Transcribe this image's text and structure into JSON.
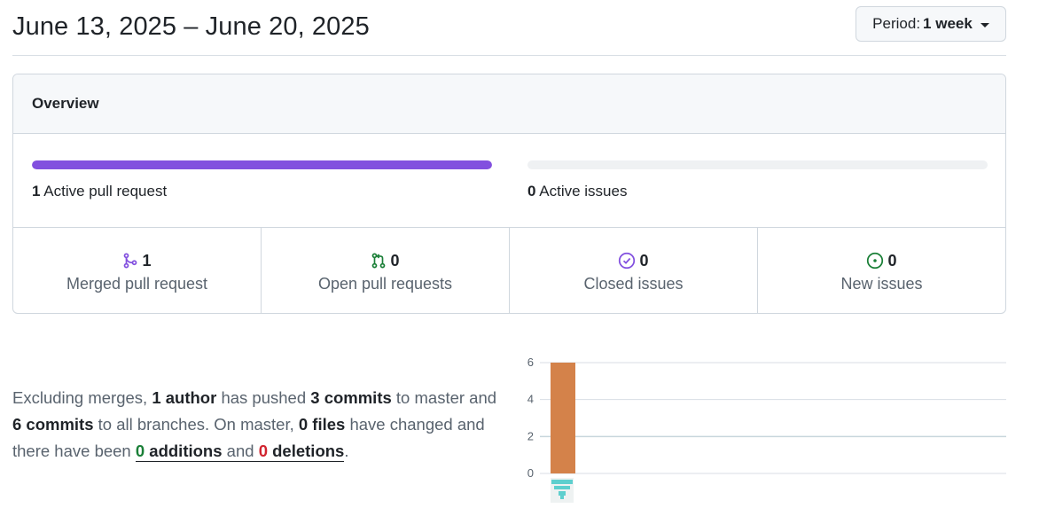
{
  "header": {
    "date_range": "June 13, 2025 – June 20, 2025",
    "period_label": "Period:",
    "period_value": "1 week"
  },
  "overview": {
    "title": "Overview",
    "pull_requests": {
      "count": "1",
      "label": "Active pull request",
      "fill_fraction": 1.0,
      "bar_color": "#8250df"
    },
    "issues": {
      "count": "0",
      "label": "Active issues",
      "fill_fraction": 0.0
    },
    "stats": [
      {
        "icon": "git-merge-icon",
        "value": "1",
        "label": "Merged pull request",
        "icon_color": "#8250df"
      },
      {
        "icon": "git-pull-request-icon",
        "value": "0",
        "label": "Open pull requests",
        "icon_color": "#1a7f37"
      },
      {
        "icon": "issue-closed-icon",
        "value": "0",
        "label": "Closed issues",
        "icon_color": "#8250df"
      },
      {
        "icon": "issue-opened-icon",
        "value": "0",
        "label": "New issues",
        "icon_color": "#1a7f37"
      }
    ]
  },
  "summary": {
    "part1": "Excluding merges, ",
    "authors": "1 author",
    "part2": " has pushed ",
    "commits_master": "3 commits",
    "part3": " to master and ",
    "commits_all": "6 commits",
    "part4": " to all branches. On master, ",
    "files": "0 files",
    "part5": " have changed and there have been ",
    "additions_count": "0",
    "additions_label": "additions",
    "part6": " and ",
    "deletions_count": "0",
    "deletions_label": "deletions",
    "part7": "."
  },
  "chart_data": {
    "type": "bar",
    "categories": [
      "author"
    ],
    "series": [
      {
        "values": [
          6
        ],
        "color": "#d4824a"
      }
    ],
    "y_ticks": [
      0,
      2,
      4,
      6
    ],
    "ylim": [
      0,
      6
    ],
    "grid": true,
    "avatar_icon": "author-avatar-icon"
  }
}
